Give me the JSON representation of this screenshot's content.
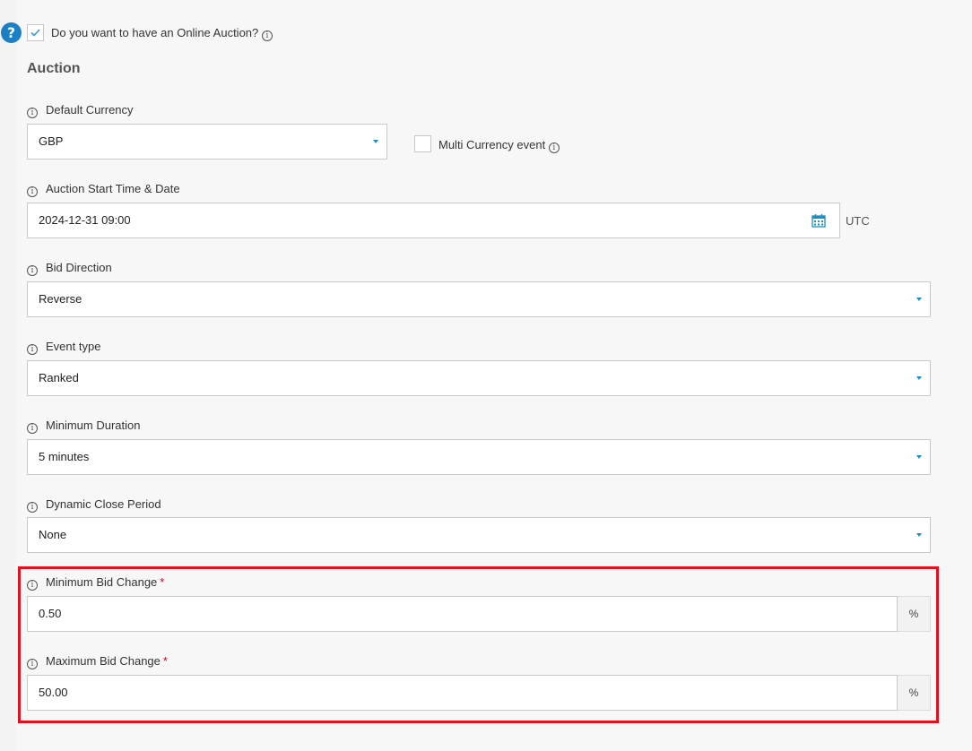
{
  "online_auction": {
    "question": "Do you want to have an Online Auction?",
    "checked": true
  },
  "section_title": "Auction",
  "fields": {
    "default_currency": {
      "label": "Default Currency",
      "value": "GBP"
    },
    "multi_currency": {
      "label": "Multi Currency event",
      "checked": false
    },
    "start_time": {
      "label": "Auction Start Time & Date",
      "value": "2024-12-31 09:00",
      "timezone": "UTC"
    },
    "bid_direction": {
      "label": "Bid Direction",
      "value": "Reverse"
    },
    "event_type": {
      "label": "Event type",
      "value": "Ranked"
    },
    "minimum_duration": {
      "label": "Minimum Duration",
      "value": "5 minutes"
    },
    "dynamic_close": {
      "label": "Dynamic Close Period",
      "value": "None"
    },
    "min_bid_change": {
      "label": "Minimum Bid Change",
      "required_mark": "*",
      "value": "0.50",
      "unit": "%"
    },
    "max_bid_change": {
      "label": "Maximum Bid Change",
      "required_mark": "*",
      "value": "50.00",
      "unit": "%"
    }
  },
  "colors": {
    "accent": "#1a8fc9",
    "help": "#1a7fc4",
    "highlight": "#e3101e",
    "required": "#d0021b"
  }
}
